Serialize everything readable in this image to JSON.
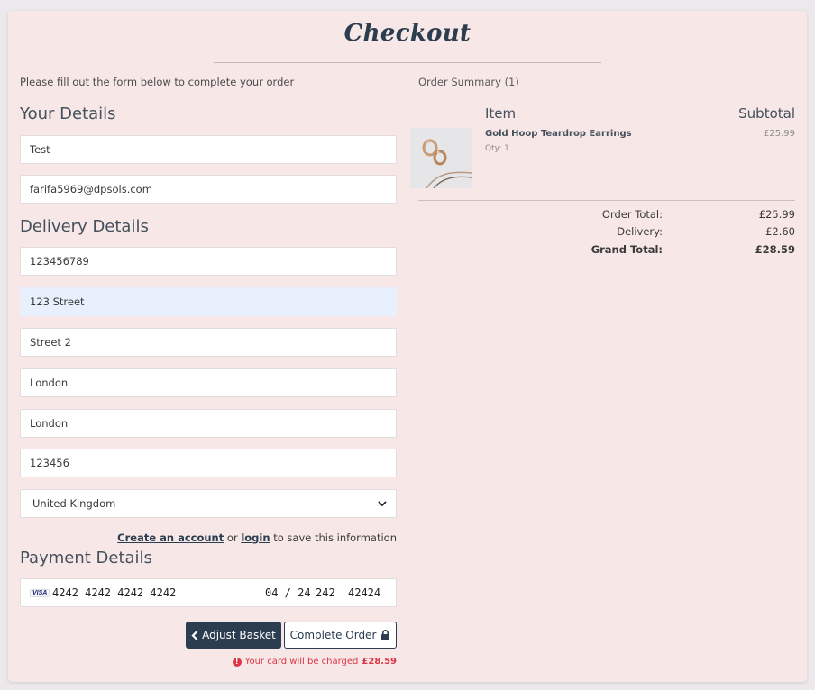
{
  "page": {
    "title": "Checkout",
    "intro": "Please fill out the form below to complete your order"
  },
  "your_details": {
    "heading": "Your Details",
    "full_name": "Test",
    "email": "farifa5969@dpsols.com"
  },
  "delivery": {
    "heading": "Delivery Details",
    "phone": "123456789",
    "street1": "123 Street",
    "street2": "Street 2",
    "town": "London",
    "county": "London",
    "postcode": "123456",
    "country": "United Kingdom"
  },
  "account_note": {
    "create_link": "Create an account",
    "or": "or",
    "login_link": "login",
    "suffix": "to save this information"
  },
  "payment": {
    "heading": "Payment Details",
    "card_brand": "VISA",
    "card_number": "4242 4242 4242 4242",
    "expiry": "04 / 24",
    "cvc": "242",
    "zip": "42424"
  },
  "buttons": {
    "adjust_basket": "Adjust Basket",
    "complete_order": "Complete Order"
  },
  "charge_note": {
    "text": "Your card will be charged",
    "amount": "£28.59"
  },
  "summary": {
    "title": "Order Summary (1)",
    "col_item": "Item",
    "col_subtotal": "Subtotal",
    "items": [
      {
        "name": "Gold Hoop Teardrop Earrings",
        "qty": "Qty: 1",
        "price": "£25.99"
      }
    ],
    "order_total_label": "Order Total:",
    "order_total": "£25.99",
    "delivery_label": "Delivery:",
    "delivery": "£2.60",
    "grand_total_label": "Grand Total:",
    "grand_total": "£28.59"
  },
  "icons": {
    "back": "chevron-left-icon",
    "lock": "lock-icon",
    "alert": "alert-circle-icon",
    "dropdown": "chevron-down-icon"
  },
  "colors": {
    "accent": "#2b3d4f",
    "card_bg": "#f7e8e7",
    "error": "#dc3545"
  }
}
